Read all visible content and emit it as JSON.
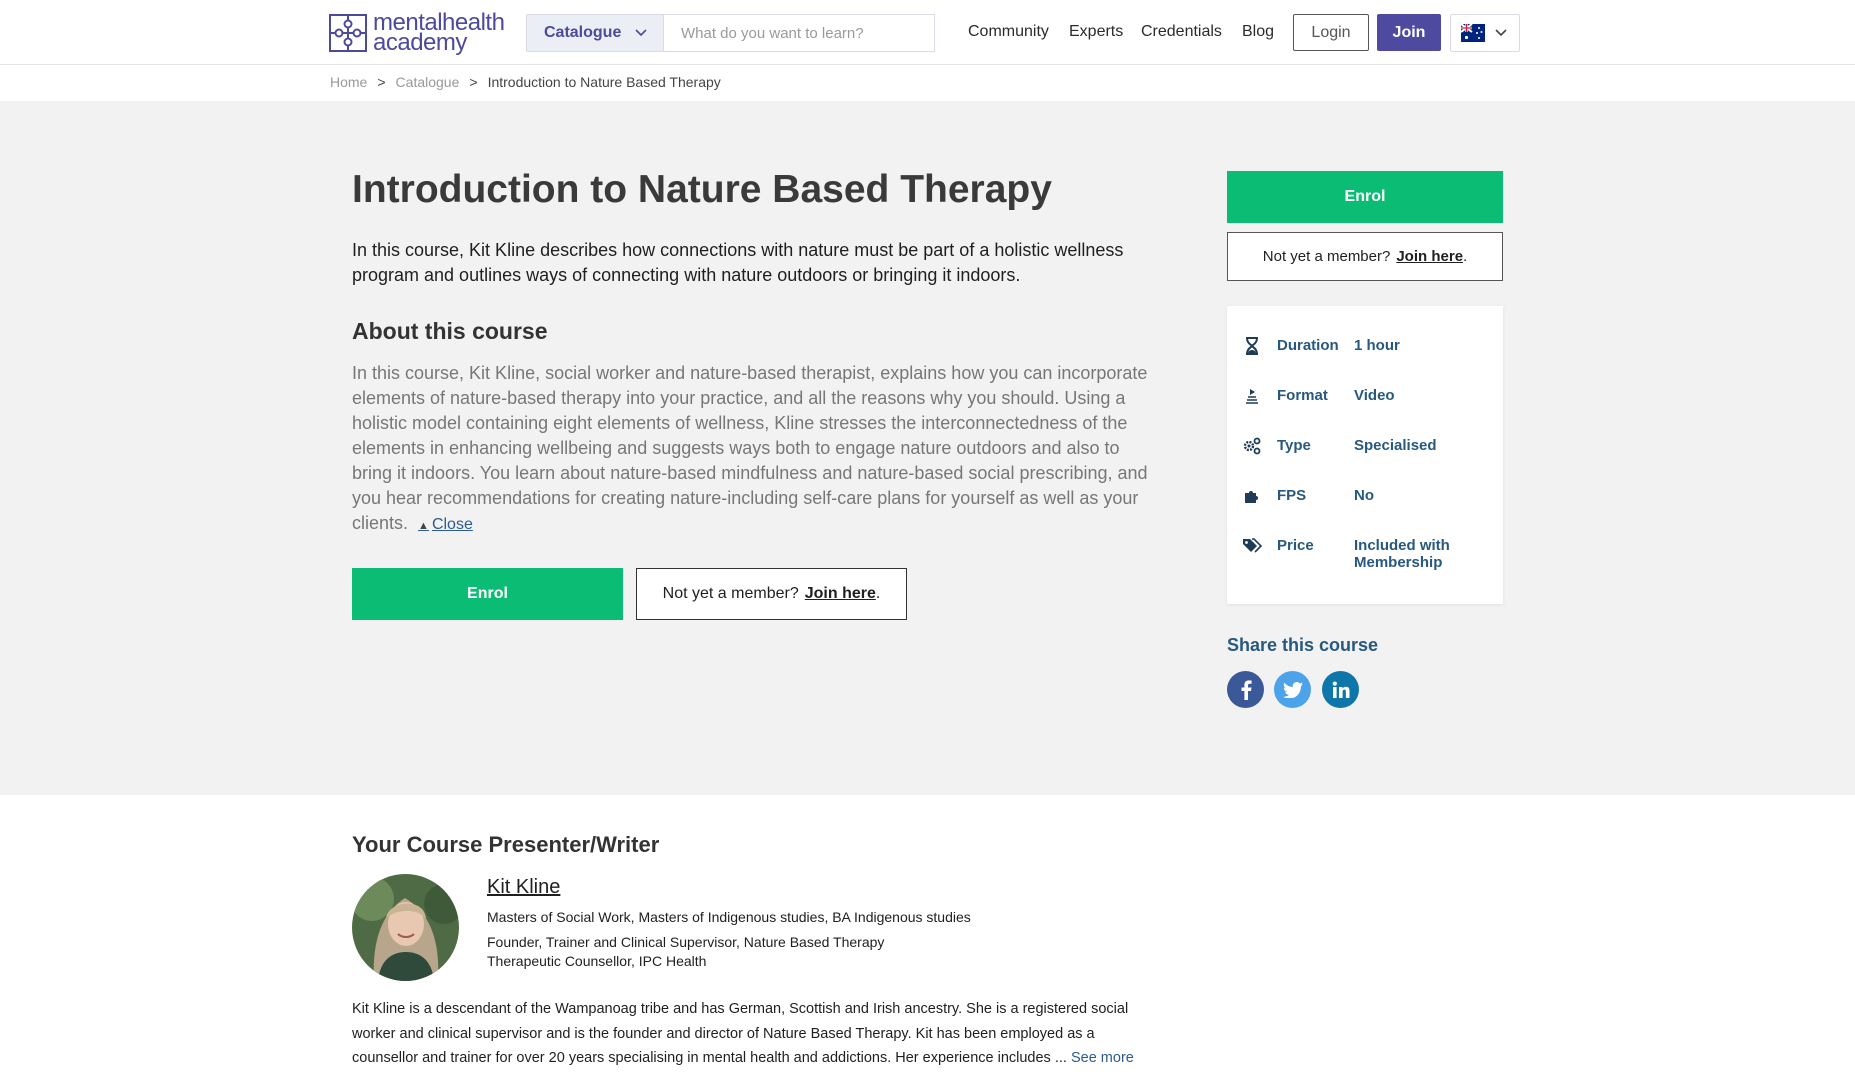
{
  "header": {
    "logo_line1": "mentalhealth",
    "logo_line2": "academy",
    "catalogue_label": "Catalogue",
    "search_placeholder": "What do you want to learn?",
    "nav": [
      "Community",
      "Experts",
      "Credentials",
      "Blog"
    ],
    "login_label": "Login",
    "join_label": "Join",
    "country_flag": "australia-flag"
  },
  "breadcrumb": {
    "home": "Home",
    "sep": ">",
    "catalogue": "Catalogue",
    "current": "Introduction to Nature Based Therapy"
  },
  "course": {
    "title": "Introduction to Nature Based Therapy",
    "lead": "In this course, Kit Kline describes how connections with nature must be part of a holistic wellness program and outlines ways of connecting with nature outdoors or bringing it indoors.",
    "about_heading": "About this course",
    "about_text": "In this course, Kit Kline, social worker and nature-based therapist, explains how you can incorporate elements of nature-based therapy into your practice, and all the reasons why you should. Using a holistic model containing eight elements of wellness, Kline stresses the interconnectedness of the elements in enhancing wellbeing and suggests ways both to engage nature outdoors and also to bring it indoors. You learn about nature-based mindfulness and nature-based social prescribing, and you hear recommendations for creating nature-including self-care plans for yourself as well as your clients.",
    "close_label": "Close",
    "enrol_label": "Enrol",
    "member_prompt": "Not yet a member?",
    "join_here": "Join here",
    "period": "."
  },
  "details": [
    {
      "icon": "hourglass-icon",
      "label": "Duration",
      "value": "1 hour"
    },
    {
      "icon": "video-icon",
      "label": "Format",
      "value": "Video"
    },
    {
      "icon": "gears-icon",
      "label": "Type",
      "value": "Specialised"
    },
    {
      "icon": "puzzle-icon",
      "label": "FPS",
      "value": "No"
    },
    {
      "icon": "tags-icon",
      "label": "Price",
      "value": "Included with Membership"
    }
  ],
  "share": {
    "heading": "Share this course",
    "networks": [
      "facebook",
      "twitter",
      "linkedin"
    ]
  },
  "presenter": {
    "heading": "Your Course Presenter/Writer",
    "name": "Kit Kline",
    "qualifications": "Masters of Social Work, Masters of Indigenous studies, BA Indigenous studies",
    "role1": "Founder, Trainer and Clinical Supervisor, Nature Based Therapy",
    "role2": "Therapeutic Counsellor, IPC Health",
    "bio": "Kit Kline is a descendant of the Wampanoag tribe and has German, Scottish and Irish ancestry. She is a registered social worker and clinical supervisor and is the founder and director of Nature Based Therapy. Kit has been employed as a counsellor and trainer for over 20 years specialising in mental health and addictions. Her experience includes ...",
    "see_more": "See more"
  },
  "colors": {
    "brand": "#4d4aa0",
    "enrol_green": "#0bbd74",
    "detail_blue": "#27597f",
    "hero_bg": "#f2f2f2"
  }
}
